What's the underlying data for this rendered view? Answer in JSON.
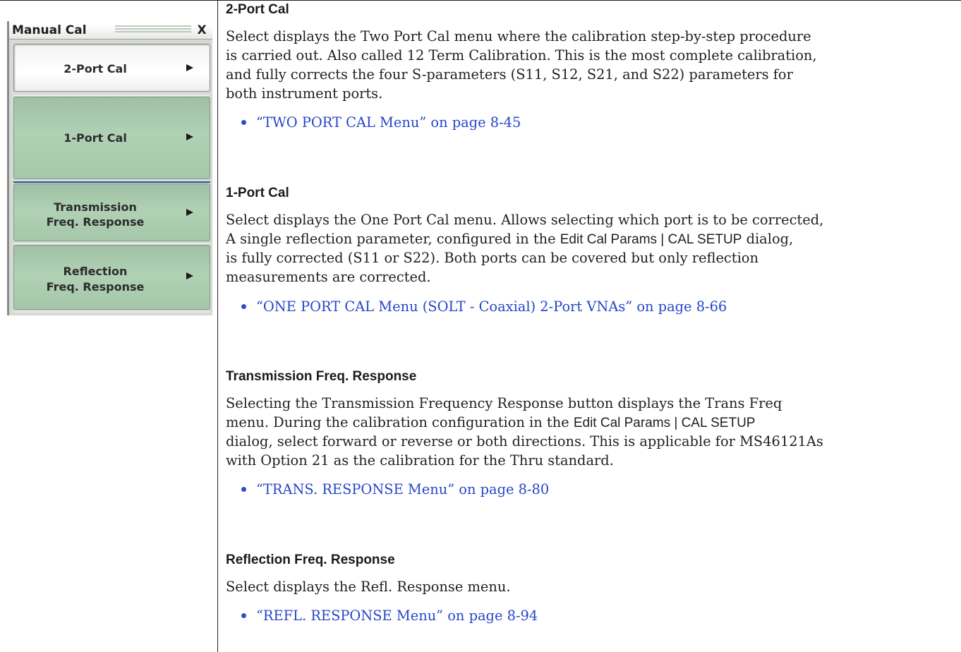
{
  "menu": {
    "title": "Manual Cal",
    "close_label": "X",
    "buttons": [
      {
        "line1": "2-Port Cal",
        "line2": ""
      },
      {
        "line1": "1-Port Cal",
        "line2": ""
      },
      {
        "line1": "Transmission",
        "line2": "Freq. Response"
      },
      {
        "line1": "Reflection",
        "line2": "Freq. Response"
      }
    ],
    "arrow_icon": "triangle-right-icon",
    "colors": {
      "button_green": "#a9caad",
      "separator_blue": "#2c4aa0"
    }
  },
  "doc": {
    "sections": [
      {
        "title": "2-Port Cal",
        "lines": [
          "Select displays the Two Port Cal menu where the calibration step-by-step procedure",
          "is carried out. Also called 12 Term Calibration. This is the most complete calibration,",
          "and fully corrects the four S-parameters (S11, S12, S21, and S22) parameters for",
          "both instrument ports."
        ],
        "link": "“TWO PORT CAL Menu” on page 8-45"
      },
      {
        "title": "1-Port Cal",
        "lines": [
          "Select displays the One Port Cal menu. Allows selecting which port is to be corrected,",
          "A single reflection parameter, configured in the ",
          "is fully corrected (S11 or S22). Both ports can be covered but only reflection",
          "measurements are corrected."
        ],
        "inline_ref": "Edit Cal Params | CAL SETUP",
        "line2_tail": " dialog,",
        "link": "“ONE PORT CAL Menu (SOLT - Coaxial) 2-Port VNAs” on page 8-66"
      },
      {
        "title": "Transmission Freq. Response",
        "lines": [
          "Selecting the Transmission Frequency Response button displays the Trans Freq",
          "menu. During the calibration configuration in the ",
          "dialog, select forward or reverse or both directions. This is applicable for MS46121As",
          "with Option 21 as the calibration for the Thru standard."
        ],
        "inline_ref": "Edit Cal Params | CAL SETUP",
        "link": "“TRANS. RESPONSE Menu” on page 8-80"
      },
      {
        "title": "Reflection Freq. Response",
        "lines": [
          "Select displays the Refl. Response menu."
        ],
        "link": "“REFL. RESPONSE Menu” on page 8-94"
      }
    ],
    "link_color": "#2446c9"
  }
}
